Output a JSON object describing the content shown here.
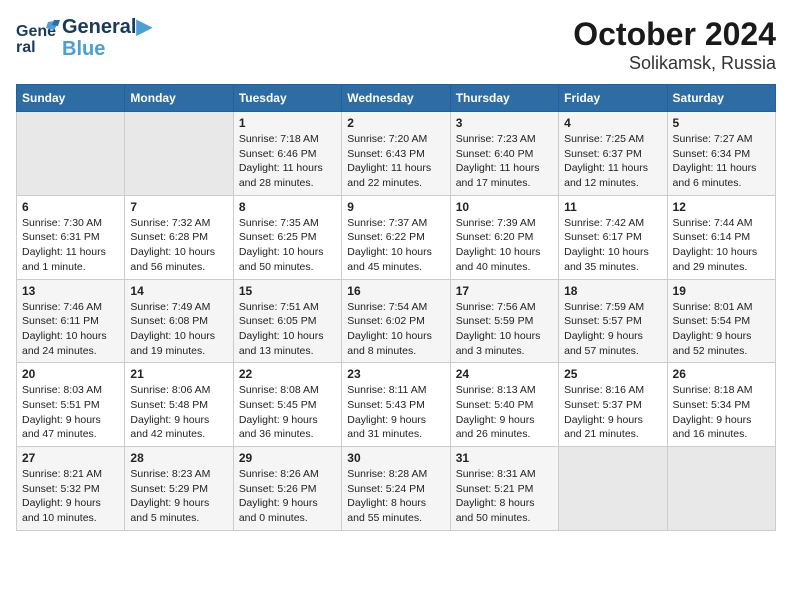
{
  "logo": {
    "line1": "General",
    "line2": "Blue"
  },
  "title": "October 2024",
  "subtitle": "Solikamsk, Russia",
  "days_header": [
    "Sunday",
    "Monday",
    "Tuesday",
    "Wednesday",
    "Thursday",
    "Friday",
    "Saturday"
  ],
  "weeks": [
    [
      {
        "day": "",
        "sunrise": "",
        "sunset": "",
        "daylight": ""
      },
      {
        "day": "",
        "sunrise": "",
        "sunset": "",
        "daylight": ""
      },
      {
        "day": "1",
        "sunrise": "Sunrise: 7:18 AM",
        "sunset": "Sunset: 6:46 PM",
        "daylight": "Daylight: 11 hours and 28 minutes."
      },
      {
        "day": "2",
        "sunrise": "Sunrise: 7:20 AM",
        "sunset": "Sunset: 6:43 PM",
        "daylight": "Daylight: 11 hours and 22 minutes."
      },
      {
        "day": "3",
        "sunrise": "Sunrise: 7:23 AM",
        "sunset": "Sunset: 6:40 PM",
        "daylight": "Daylight: 11 hours and 17 minutes."
      },
      {
        "day": "4",
        "sunrise": "Sunrise: 7:25 AM",
        "sunset": "Sunset: 6:37 PM",
        "daylight": "Daylight: 11 hours and 12 minutes."
      },
      {
        "day": "5",
        "sunrise": "Sunrise: 7:27 AM",
        "sunset": "Sunset: 6:34 PM",
        "daylight": "Daylight: 11 hours and 6 minutes."
      }
    ],
    [
      {
        "day": "6",
        "sunrise": "Sunrise: 7:30 AM",
        "sunset": "Sunset: 6:31 PM",
        "daylight": "Daylight: 11 hours and 1 minute."
      },
      {
        "day": "7",
        "sunrise": "Sunrise: 7:32 AM",
        "sunset": "Sunset: 6:28 PM",
        "daylight": "Daylight: 10 hours and 56 minutes."
      },
      {
        "day": "8",
        "sunrise": "Sunrise: 7:35 AM",
        "sunset": "Sunset: 6:25 PM",
        "daylight": "Daylight: 10 hours and 50 minutes."
      },
      {
        "day": "9",
        "sunrise": "Sunrise: 7:37 AM",
        "sunset": "Sunset: 6:22 PM",
        "daylight": "Daylight: 10 hours and 45 minutes."
      },
      {
        "day": "10",
        "sunrise": "Sunrise: 7:39 AM",
        "sunset": "Sunset: 6:20 PM",
        "daylight": "Daylight: 10 hours and 40 minutes."
      },
      {
        "day": "11",
        "sunrise": "Sunrise: 7:42 AM",
        "sunset": "Sunset: 6:17 PM",
        "daylight": "Daylight: 10 hours and 35 minutes."
      },
      {
        "day": "12",
        "sunrise": "Sunrise: 7:44 AM",
        "sunset": "Sunset: 6:14 PM",
        "daylight": "Daylight: 10 hours and 29 minutes."
      }
    ],
    [
      {
        "day": "13",
        "sunrise": "Sunrise: 7:46 AM",
        "sunset": "Sunset: 6:11 PM",
        "daylight": "Daylight: 10 hours and 24 minutes."
      },
      {
        "day": "14",
        "sunrise": "Sunrise: 7:49 AM",
        "sunset": "Sunset: 6:08 PM",
        "daylight": "Daylight: 10 hours and 19 minutes."
      },
      {
        "day": "15",
        "sunrise": "Sunrise: 7:51 AM",
        "sunset": "Sunset: 6:05 PM",
        "daylight": "Daylight: 10 hours and 13 minutes."
      },
      {
        "day": "16",
        "sunrise": "Sunrise: 7:54 AM",
        "sunset": "Sunset: 6:02 PM",
        "daylight": "Daylight: 10 hours and 8 minutes."
      },
      {
        "day": "17",
        "sunrise": "Sunrise: 7:56 AM",
        "sunset": "Sunset: 5:59 PM",
        "daylight": "Daylight: 10 hours and 3 minutes."
      },
      {
        "day": "18",
        "sunrise": "Sunrise: 7:59 AM",
        "sunset": "Sunset: 5:57 PM",
        "daylight": "Daylight: 9 hours and 57 minutes."
      },
      {
        "day": "19",
        "sunrise": "Sunrise: 8:01 AM",
        "sunset": "Sunset: 5:54 PM",
        "daylight": "Daylight: 9 hours and 52 minutes."
      }
    ],
    [
      {
        "day": "20",
        "sunrise": "Sunrise: 8:03 AM",
        "sunset": "Sunset: 5:51 PM",
        "daylight": "Daylight: 9 hours and 47 minutes."
      },
      {
        "day": "21",
        "sunrise": "Sunrise: 8:06 AM",
        "sunset": "Sunset: 5:48 PM",
        "daylight": "Daylight: 9 hours and 42 minutes."
      },
      {
        "day": "22",
        "sunrise": "Sunrise: 8:08 AM",
        "sunset": "Sunset: 5:45 PM",
        "daylight": "Daylight: 9 hours and 36 minutes."
      },
      {
        "day": "23",
        "sunrise": "Sunrise: 8:11 AM",
        "sunset": "Sunset: 5:43 PM",
        "daylight": "Daylight: 9 hours and 31 minutes."
      },
      {
        "day": "24",
        "sunrise": "Sunrise: 8:13 AM",
        "sunset": "Sunset: 5:40 PM",
        "daylight": "Daylight: 9 hours and 26 minutes."
      },
      {
        "day": "25",
        "sunrise": "Sunrise: 8:16 AM",
        "sunset": "Sunset: 5:37 PM",
        "daylight": "Daylight: 9 hours and 21 minutes."
      },
      {
        "day": "26",
        "sunrise": "Sunrise: 8:18 AM",
        "sunset": "Sunset: 5:34 PM",
        "daylight": "Daylight: 9 hours and 16 minutes."
      }
    ],
    [
      {
        "day": "27",
        "sunrise": "Sunrise: 8:21 AM",
        "sunset": "Sunset: 5:32 PM",
        "daylight": "Daylight: 9 hours and 10 minutes."
      },
      {
        "day": "28",
        "sunrise": "Sunrise: 8:23 AM",
        "sunset": "Sunset: 5:29 PM",
        "daylight": "Daylight: 9 hours and 5 minutes."
      },
      {
        "day": "29",
        "sunrise": "Sunrise: 8:26 AM",
        "sunset": "Sunset: 5:26 PM",
        "daylight": "Daylight: 9 hours and 0 minutes."
      },
      {
        "day": "30",
        "sunrise": "Sunrise: 8:28 AM",
        "sunset": "Sunset: 5:24 PM",
        "daylight": "Daylight: 8 hours and 55 minutes."
      },
      {
        "day": "31",
        "sunrise": "Sunrise: 8:31 AM",
        "sunset": "Sunset: 5:21 PM",
        "daylight": "Daylight: 8 hours and 50 minutes."
      },
      {
        "day": "",
        "sunrise": "",
        "sunset": "",
        "daylight": ""
      },
      {
        "day": "",
        "sunrise": "",
        "sunset": "",
        "daylight": ""
      }
    ]
  ]
}
